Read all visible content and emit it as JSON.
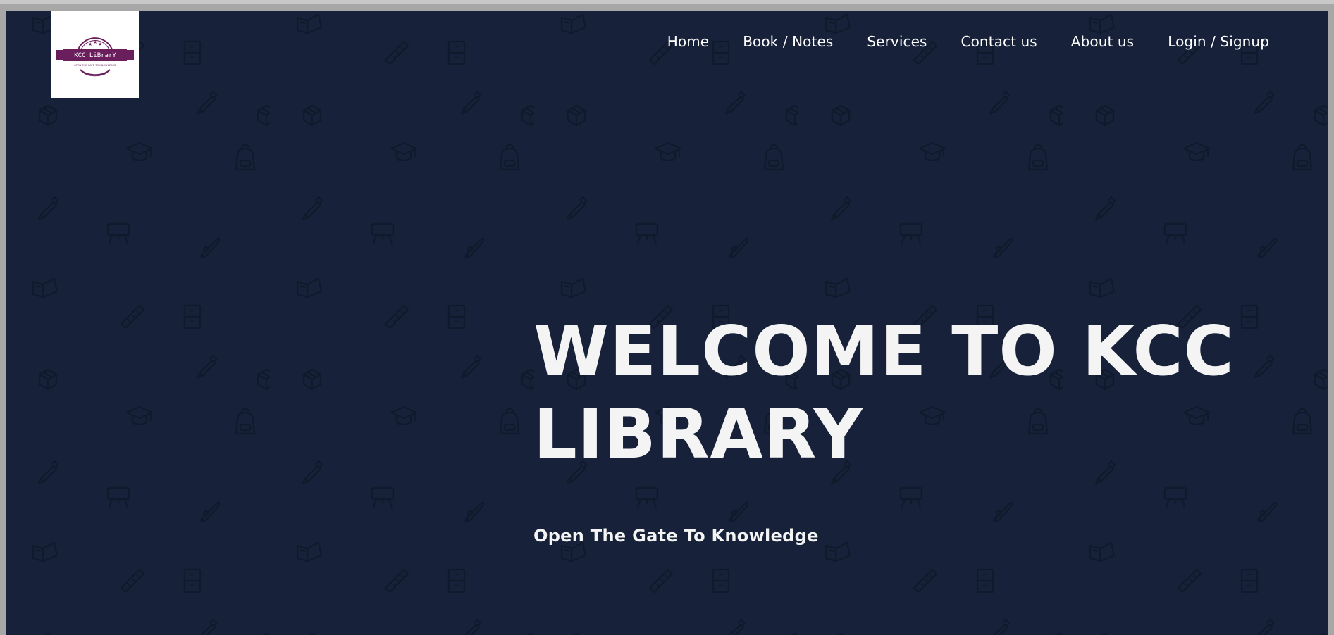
{
  "logo": {
    "brand_text": "KCC LiBrarY",
    "tagline_text": "OPEN THE GATE TO KNOWLEDGE",
    "colors": {
      "ribbon": "#6b1e5c",
      "ring": "#6b1e5c"
    }
  },
  "nav": {
    "items": [
      {
        "label": "Home"
      },
      {
        "label": "Book / Notes"
      },
      {
        "label": "Services"
      },
      {
        "label": "Contact us"
      },
      {
        "label": "About us"
      },
      {
        "label": "Login / Signup"
      }
    ]
  },
  "hero": {
    "title": "WELCOME TO KCC LIBRARY",
    "subtitle": "Open The Gate To Knowledge"
  },
  "theme": {
    "background": "#17223a",
    "pattern_stroke": "#0f1a2c",
    "text": "#f4f4f5"
  },
  "pattern_icons": [
    "pencil-icon",
    "cube-icon",
    "graduation-cap-icon",
    "backpack-icon",
    "easel-icon",
    "diploma-icon",
    "open-book-icon",
    "ruler-icon",
    "locker-icon"
  ]
}
